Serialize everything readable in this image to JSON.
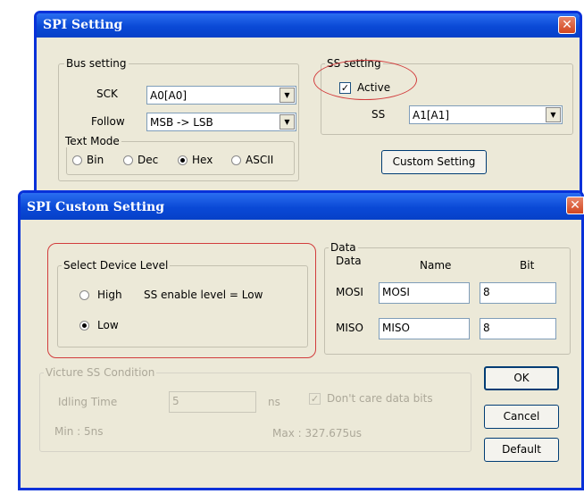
{
  "spi_setting": {
    "title": "SPI Setting",
    "bus_setting": {
      "legend": "Bus setting",
      "sck_label": "SCK",
      "sck_value": "A0[A0]",
      "follow_label": "Follow",
      "follow_value": "MSB -> LSB",
      "text_mode": {
        "legend": "Text Mode",
        "options": [
          "Bin",
          "Dec",
          "Hex",
          "ASCII"
        ],
        "selected": "Hex"
      }
    },
    "ss_setting": {
      "legend": "SS setting",
      "active_label": "Active",
      "active_checked": true,
      "ss_label": "SS",
      "ss_value": "A1[A1]"
    },
    "custom_setting_button": "Custom Setting"
  },
  "custom_dialog": {
    "title": "SPI Custom Setting",
    "device_level": {
      "legend": "Select Device Level",
      "high_label": "High",
      "low_label": "Low",
      "selected": "Low",
      "ss_enable_text": "SS enable level  = Low"
    },
    "data": {
      "legend": "Data",
      "col_data": "Data",
      "col_name": "Name",
      "col_bit": "Bit",
      "rows": [
        {
          "label": "MOSI",
          "name": "MOSI",
          "bit": "8"
        },
        {
          "label": "MISO",
          "name": "MISO",
          "bit": "8"
        }
      ]
    },
    "ss_condition": {
      "legend": "Victure SS Condition",
      "idling_label": "Idling Time",
      "idling_value": "5",
      "unit": "ns",
      "dont_care_label": "Don't care data bits",
      "min_text": "Min : 5ns",
      "max_text": "Max : 327.675us"
    },
    "buttons": {
      "ok": "OK",
      "cancel": "Cancel",
      "default": "Default"
    }
  },
  "icons": {
    "close": "close-icon",
    "dropdown": "chevron-down-icon"
  },
  "colors": {
    "title_bar": "#0a49d6",
    "window_bg": "#ece9d8",
    "annotation": "#d23c3c"
  }
}
